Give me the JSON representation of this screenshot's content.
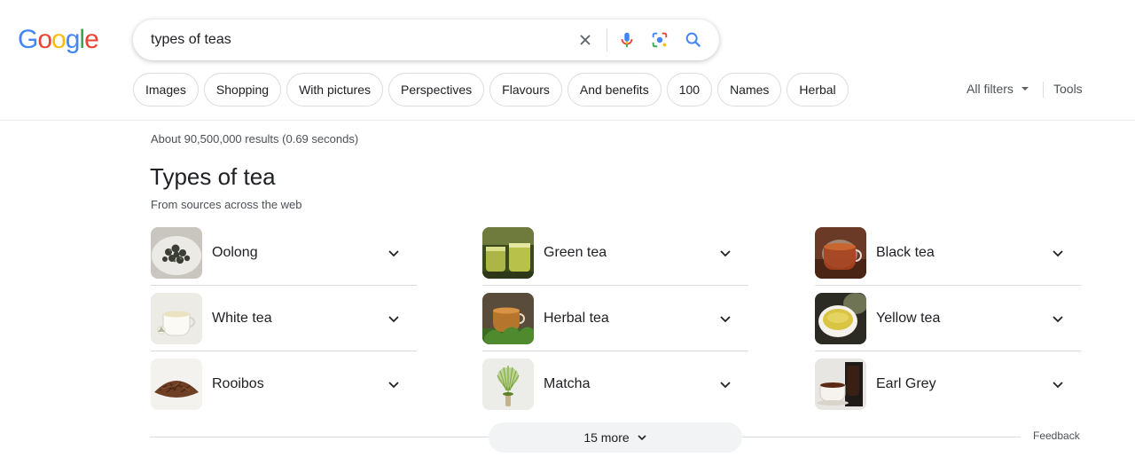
{
  "logo": {
    "letters": [
      {
        "ch": "G",
        "color": "#4285F4"
      },
      {
        "ch": "o",
        "color": "#EA4335"
      },
      {
        "ch": "o",
        "color": "#FBBC05"
      },
      {
        "ch": "g",
        "color": "#4285F4"
      },
      {
        "ch": "l",
        "color": "#34A853"
      },
      {
        "ch": "e",
        "color": "#EA4335"
      }
    ]
  },
  "search": {
    "query": "types of teas",
    "icons": [
      "clear-icon",
      "microphone-icon",
      "lens-icon",
      "search-icon"
    ]
  },
  "chips": [
    "Images",
    "Shopping",
    "With pictures",
    "Perspectives",
    "Flavours",
    "And benefits",
    "100",
    "Names",
    "Herbal"
  ],
  "filters": {
    "all_filters": "All filters",
    "tools": "Tools"
  },
  "result_stats": "About 90,500,000 results (0.69 seconds)",
  "section": {
    "title": "Types of tea",
    "subtitle": "From sources across the web"
  },
  "teas": [
    {
      "label": "Oolong",
      "image": "oolong-leaves"
    },
    {
      "label": "Green tea",
      "image": "green-tea-cups"
    },
    {
      "label": "Black tea",
      "image": "black-tea-cup"
    },
    {
      "label": "White tea",
      "image": "white-tea-cup"
    },
    {
      "label": "Herbal tea",
      "image": "herbal-tea-cup"
    },
    {
      "label": "Yellow tea",
      "image": "yellow-tea-bowl"
    },
    {
      "label": "Rooibos",
      "image": "rooibos-leaves"
    },
    {
      "label": "Matcha",
      "image": "matcha-whisk"
    },
    {
      "label": "Earl Grey",
      "image": "earl-grey-cup"
    }
  ],
  "more_button": "15 more",
  "feedback": "Feedback",
  "colors": {
    "accent_blue": "#1a73e8",
    "text": "#202124",
    "secondary_text": "#4d5156",
    "border": "#dadce0"
  }
}
